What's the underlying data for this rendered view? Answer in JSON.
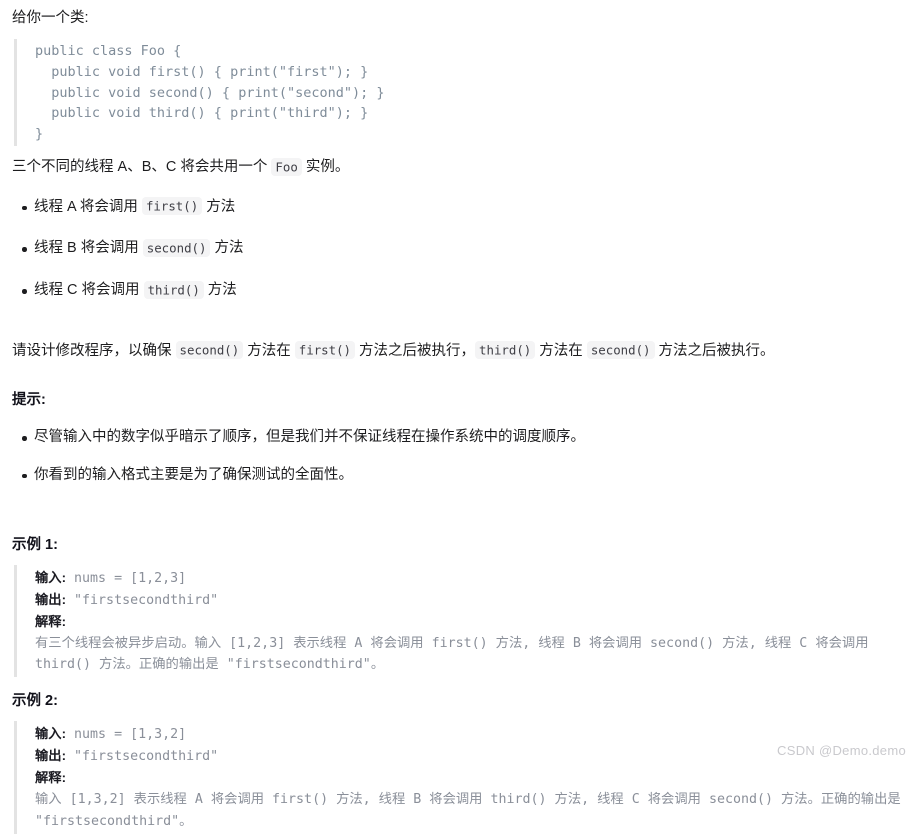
{
  "intro": {
    "lead": "给你一个类:"
  },
  "class_code": "public class Foo {\n  public void first() { print(\"first\"); }\n  public void second() { print(\"second\"); }\n  public void third() { print(\"third\"); }\n}",
  "threads_intro": {
    "before": "三个不同的线程 A、B、C 将会共用一个 ",
    "chip": "Foo",
    "after": " 实例。"
  },
  "thread_items": [
    {
      "before": "线程 A 将会调用 ",
      "chip": "first()",
      "after": " 方法"
    },
    {
      "before": "线程 B 将会调用 ",
      "chip": "second()",
      "after": " 方法"
    },
    {
      "before": "线程 C 将会调用 ",
      "chip": "third()",
      "after": " 方法"
    }
  ],
  "requirement": {
    "part1": "请设计修改程序，以确保 ",
    "chip1": "second()",
    "part2": " 方法在 ",
    "chip2": "first()",
    "part3": " 方法之后被执行，",
    "chip3": "third()",
    "part4": " 方法在 ",
    "chip4": "second()",
    "part5": " 方法之后被执行。"
  },
  "hints": {
    "title": "提示:",
    "items": [
      "尽管输入中的数字似乎暗示了顺序，但是我们并不保证线程在操作系统中的调度顺序。",
      "你看到的输入格式主要是为了确保测试的全面性。"
    ]
  },
  "examples": [
    {
      "heading": "示例 1:",
      "input_label": "输入:",
      "input_value": " nums = [1,2,3]",
      "output_label": "输出:",
      "output_value": " \"firstsecondthird\"",
      "explain_label": "解释:",
      "explain_body": "有三个线程会被异步启动。输入 [1,2,3] 表示线程 A 将会调用 first() 方法, 线程 B 将会调用 second() 方法, 线程 C 将会调用 third() 方法。正确的输出是 \"firstsecondthird\"。"
    },
    {
      "heading": "示例 2:",
      "input_label": "输入:",
      "input_value": " nums = [1,3,2]",
      "output_label": "输出:",
      "output_value": " \"firstsecondthird\"",
      "explain_label": "解释:",
      "explain_body": "输入 [1,3,2] 表示线程 A 将会调用 first() 方法, 线程 B 将会调用 third() 方法, 线程 C 将会调用 second() 方法。正确的输出是 \"firstsecondthird\"。"
    }
  ],
  "watermark": "CSDN @Demo.demo"
}
